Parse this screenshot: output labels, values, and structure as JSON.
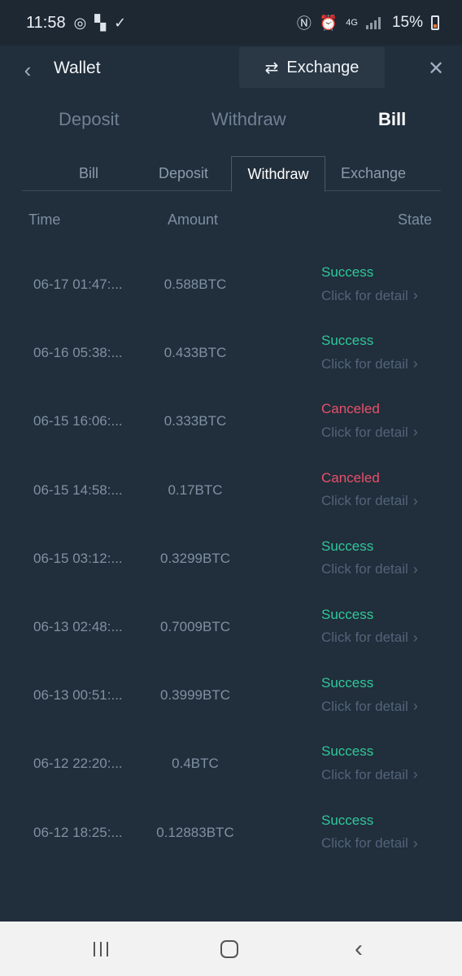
{
  "status_bar": {
    "time": "11:58",
    "battery": "15%"
  },
  "header": {
    "title": "Wallet",
    "exchange_label": "Exchange"
  },
  "main_tabs": [
    {
      "label": "Deposit"
    },
    {
      "label": "Withdraw"
    },
    {
      "label": "Bill",
      "active": true
    }
  ],
  "sub_tabs": [
    {
      "label": "Bill"
    },
    {
      "label": "Deposit"
    },
    {
      "label": "Withdraw",
      "active": true
    },
    {
      "label": "Exchange"
    }
  ],
  "table": {
    "headers": {
      "time": "Time",
      "amount": "Amount",
      "state": "State"
    },
    "detail_label": "Click for detail",
    "rows": [
      {
        "time": "06-17 01:47:...",
        "amount": "0.588BTC",
        "state": "Success"
      },
      {
        "time": "06-16 05:38:...",
        "amount": "0.433BTC",
        "state": "Success"
      },
      {
        "time": "06-15 16:06:...",
        "amount": "0.333BTC",
        "state": "Canceled"
      },
      {
        "time": "06-15 14:58:...",
        "amount": "0.17BTC",
        "state": "Canceled"
      },
      {
        "time": "06-15 03:12:...",
        "amount": "0.3299BTC",
        "state": "Success"
      },
      {
        "time": "06-13 02:48:...",
        "amount": "0.7009BTC",
        "state": "Success"
      },
      {
        "time": "06-13 00:51:...",
        "amount": "0.3999BTC",
        "state": "Success"
      },
      {
        "time": "06-12 22:20:...",
        "amount": "0.4BTC",
        "state": "Success"
      },
      {
        "time": "06-12 18:25:...",
        "amount": "0.12883BTC",
        "state": "Success"
      }
    ]
  },
  "colors": {
    "background": "#212e3b",
    "success": "#2fc89a",
    "canceled": "#e8516a"
  }
}
